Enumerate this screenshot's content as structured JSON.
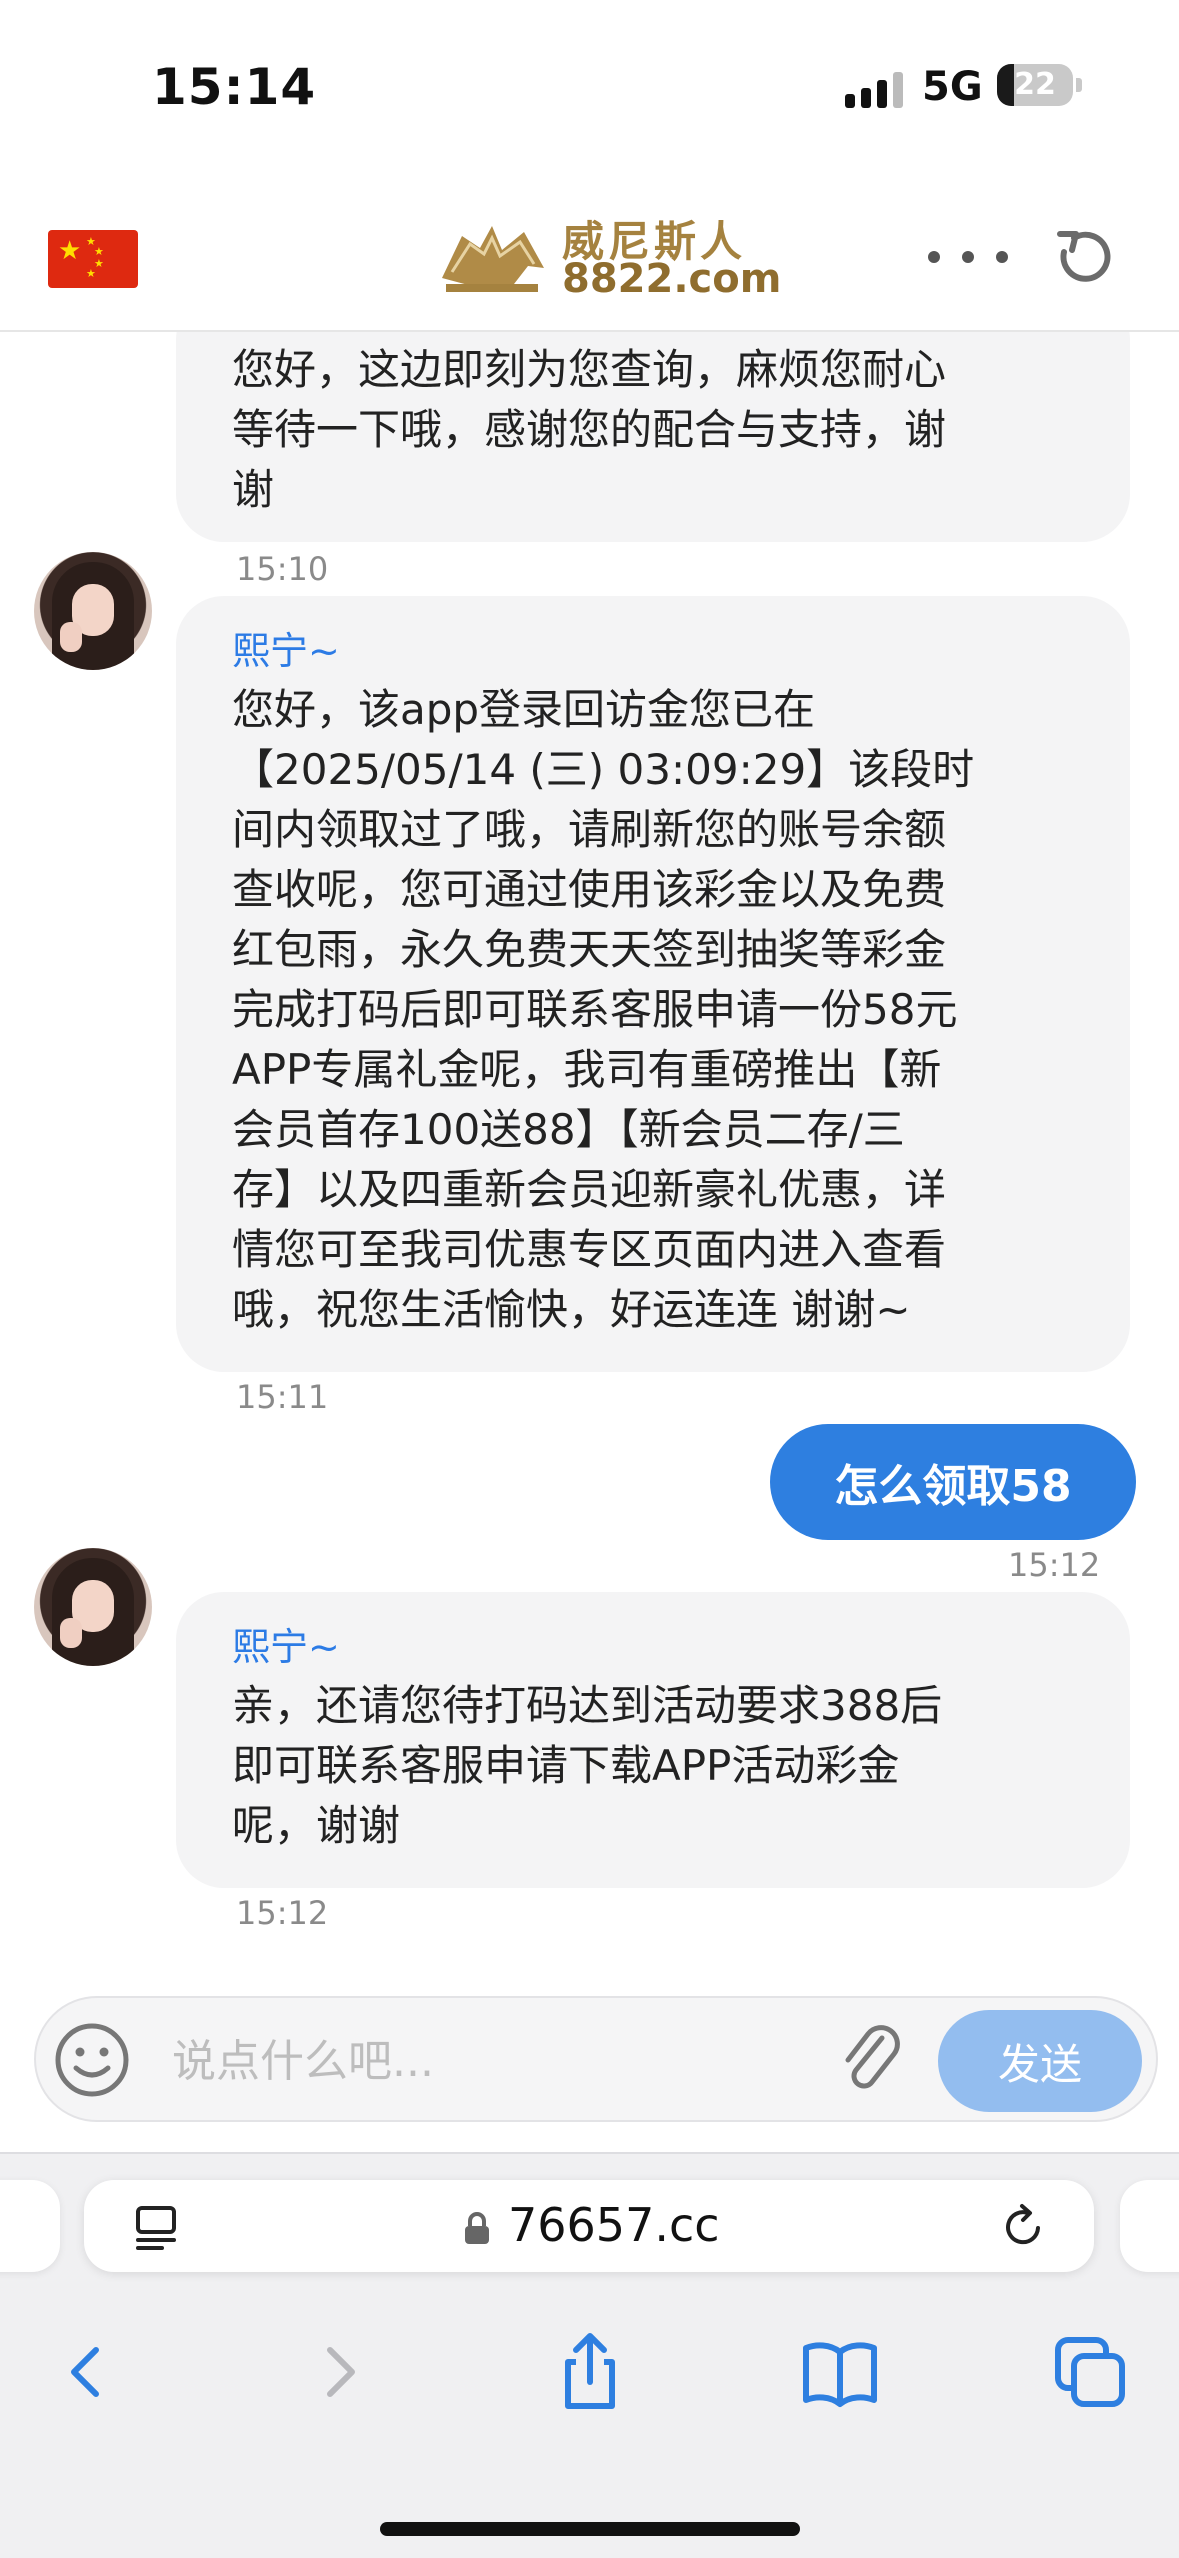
{
  "status_bar": {
    "time": "15:14",
    "network": "5G",
    "battery": "22",
    "battery_level": 0.22
  },
  "header": {
    "logo_cn": "威尼斯人",
    "logo_en": "8822.com"
  },
  "messages": [
    {
      "kind": "agent",
      "text": "您好，这边即刻为您查询，麻烦您耐心\n等待一下哦，感谢您的配合与支持，谢\n谢",
      "time": "15:10"
    },
    {
      "kind": "agent",
      "sender": "熙宁~",
      "text": "您好，该app登录回访金您已在\n【2025/05/14 (三) 03:09:29】该段时\n间内领取过了哦，请刷新您的账号余额\n查收呢，您可通过使用该彩金以及免费\n红包雨，永久免费天天签到抽奖等彩金\n完成打码后即可联系客服申请一份58元\nAPP专属礼金呢，我司有重磅推出【新\n会员首存100送88】【新会员二存/三\n存】以及四重新会员迎新豪礼优惠，详\n情您可至我司优惠专区页面内进入查看\n哦，祝您生活愉快，好运连连 谢谢~",
      "time": "15:11"
    },
    {
      "kind": "user",
      "text": "怎么领取58",
      "time": "15:12"
    },
    {
      "kind": "agent",
      "sender": "熙宁~",
      "text": "亲，还请您待打码达到活动要求388后\n即可联系客服申请下载APP活动彩金\n呢，谢谢",
      "time": "15:12"
    }
  ],
  "input": {
    "placeholder": "说点什么吧...",
    "value": "",
    "send_label": "发送"
  },
  "browser": {
    "url": "76657.cc"
  },
  "colors": {
    "accent": "#2e7fe0",
    "send_disabled": "#93bdef",
    "sender_name": "#2c7be5",
    "bubble_in": "#f4f4f5"
  }
}
